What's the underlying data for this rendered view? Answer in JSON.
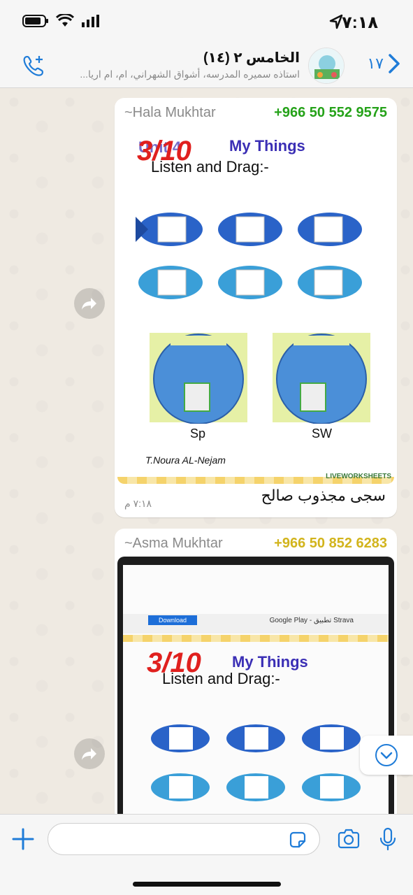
{
  "status": {
    "time": "٧:١٨"
  },
  "header": {
    "back_count": "١٧",
    "title": "الخامس ٢ (١٤)",
    "subtitle": "استاذه سميره المدرسه، أشواق الشهراني، ام، ام اريا..."
  },
  "messages": [
    {
      "sender_name": "~Hala Mukhtar",
      "sender_phone": "+966 50 552 9575",
      "phone_color": "#25a219",
      "caption": "سجى مجذوب صالح",
      "time": "٧:١٨ م",
      "worksheet": {
        "title": "My Things",
        "subtitle": "Listen and Drag:-",
        "score": "3/10",
        "bowl_left": "Sp",
        "bowl_right": "SW",
        "author": "T.Noura AL-Nejam",
        "brand": "LIVEWORKSHEETS"
      }
    },
    {
      "sender_name": "~Asma Mukhtar",
      "sender_phone": "+966 50 852 6283",
      "phone_color": "#d2b41c",
      "worksheet": {
        "title": "My Things",
        "subtitle": "Listen and Drag:-",
        "score": "3/10",
        "download": "Download",
        "play_text": "Google Play - تطبيق Strava"
      }
    }
  ],
  "colors": {
    "accent": "#1f7cd8"
  }
}
